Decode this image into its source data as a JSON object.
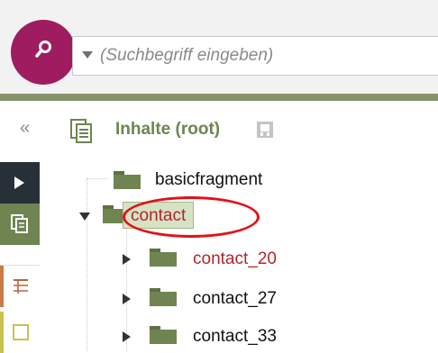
{
  "search": {
    "placeholder": "(Suchbegriff eingeben)",
    "value": ""
  },
  "header": {
    "collapse_glyph": "«",
    "title": "Inhalte (root)"
  },
  "tree": {
    "items": [
      {
        "label": "basicfragment",
        "state": "leaf"
      },
      {
        "label": "contact",
        "state": "expanded",
        "selected": true
      },
      {
        "label": "contact_20",
        "state": "collapsed",
        "highlight": true
      },
      {
        "label": "contact_27",
        "state": "collapsed"
      },
      {
        "label": "contact_33",
        "state": "collapsed"
      }
    ]
  },
  "colors": {
    "brand": "#9e1c5f",
    "accent": "#6f8451",
    "highlight_text": "#b0262c",
    "annotation_ring": "#e0121a"
  },
  "icons": [
    "search-icon",
    "dropdown-caret-icon",
    "collapse-icon",
    "documents-icon",
    "lock-icon",
    "play-icon",
    "table-icon",
    "folder-icon"
  ]
}
